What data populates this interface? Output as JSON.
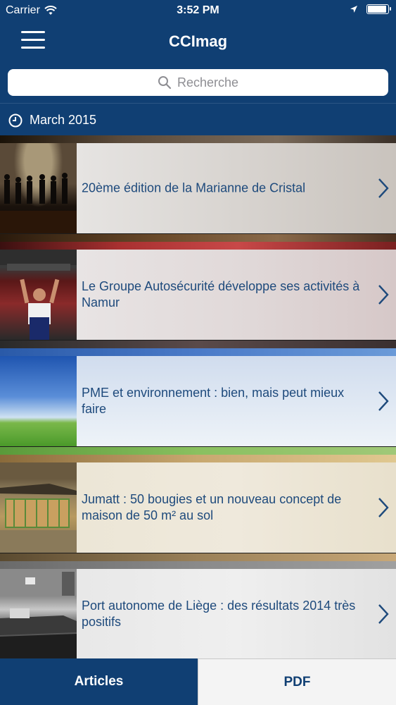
{
  "status_bar": {
    "carrier": "Carrier",
    "time": "3:52 PM",
    "battery_level": 0.92,
    "icons": [
      "wifi-icon",
      "location-arrow-icon",
      "battery-icon"
    ]
  },
  "nav": {
    "title": "CCImag",
    "menu_icon": "hamburger-icon"
  },
  "search": {
    "placeholder": "Recherche",
    "icon": "search-icon"
  },
  "section": {
    "label": "March 2015",
    "icon": "clock-icon"
  },
  "articles": [
    {
      "title": "20ème édition de la Marianne de Cristal"
    },
    {
      "title": "Le Groupe Autosécurité développe ses activités à Namur"
    },
    {
      "title": "PME et environnement : bien, mais peut mieux faire"
    },
    {
      "title": "Jumatt : 50 bougies et un nouveau concept de maison de 50 m² au sol"
    },
    {
      "title": "Port autonome de Liège : des résultats 2014 très positifs"
    }
  ],
  "tabs": {
    "articles": "Articles",
    "pdf": "PDF",
    "active": "Articles"
  },
  "colors": {
    "brand": "#103f73",
    "article_title": "#1e4a7c",
    "tab_inactive_bg": "#f4f4f4"
  }
}
